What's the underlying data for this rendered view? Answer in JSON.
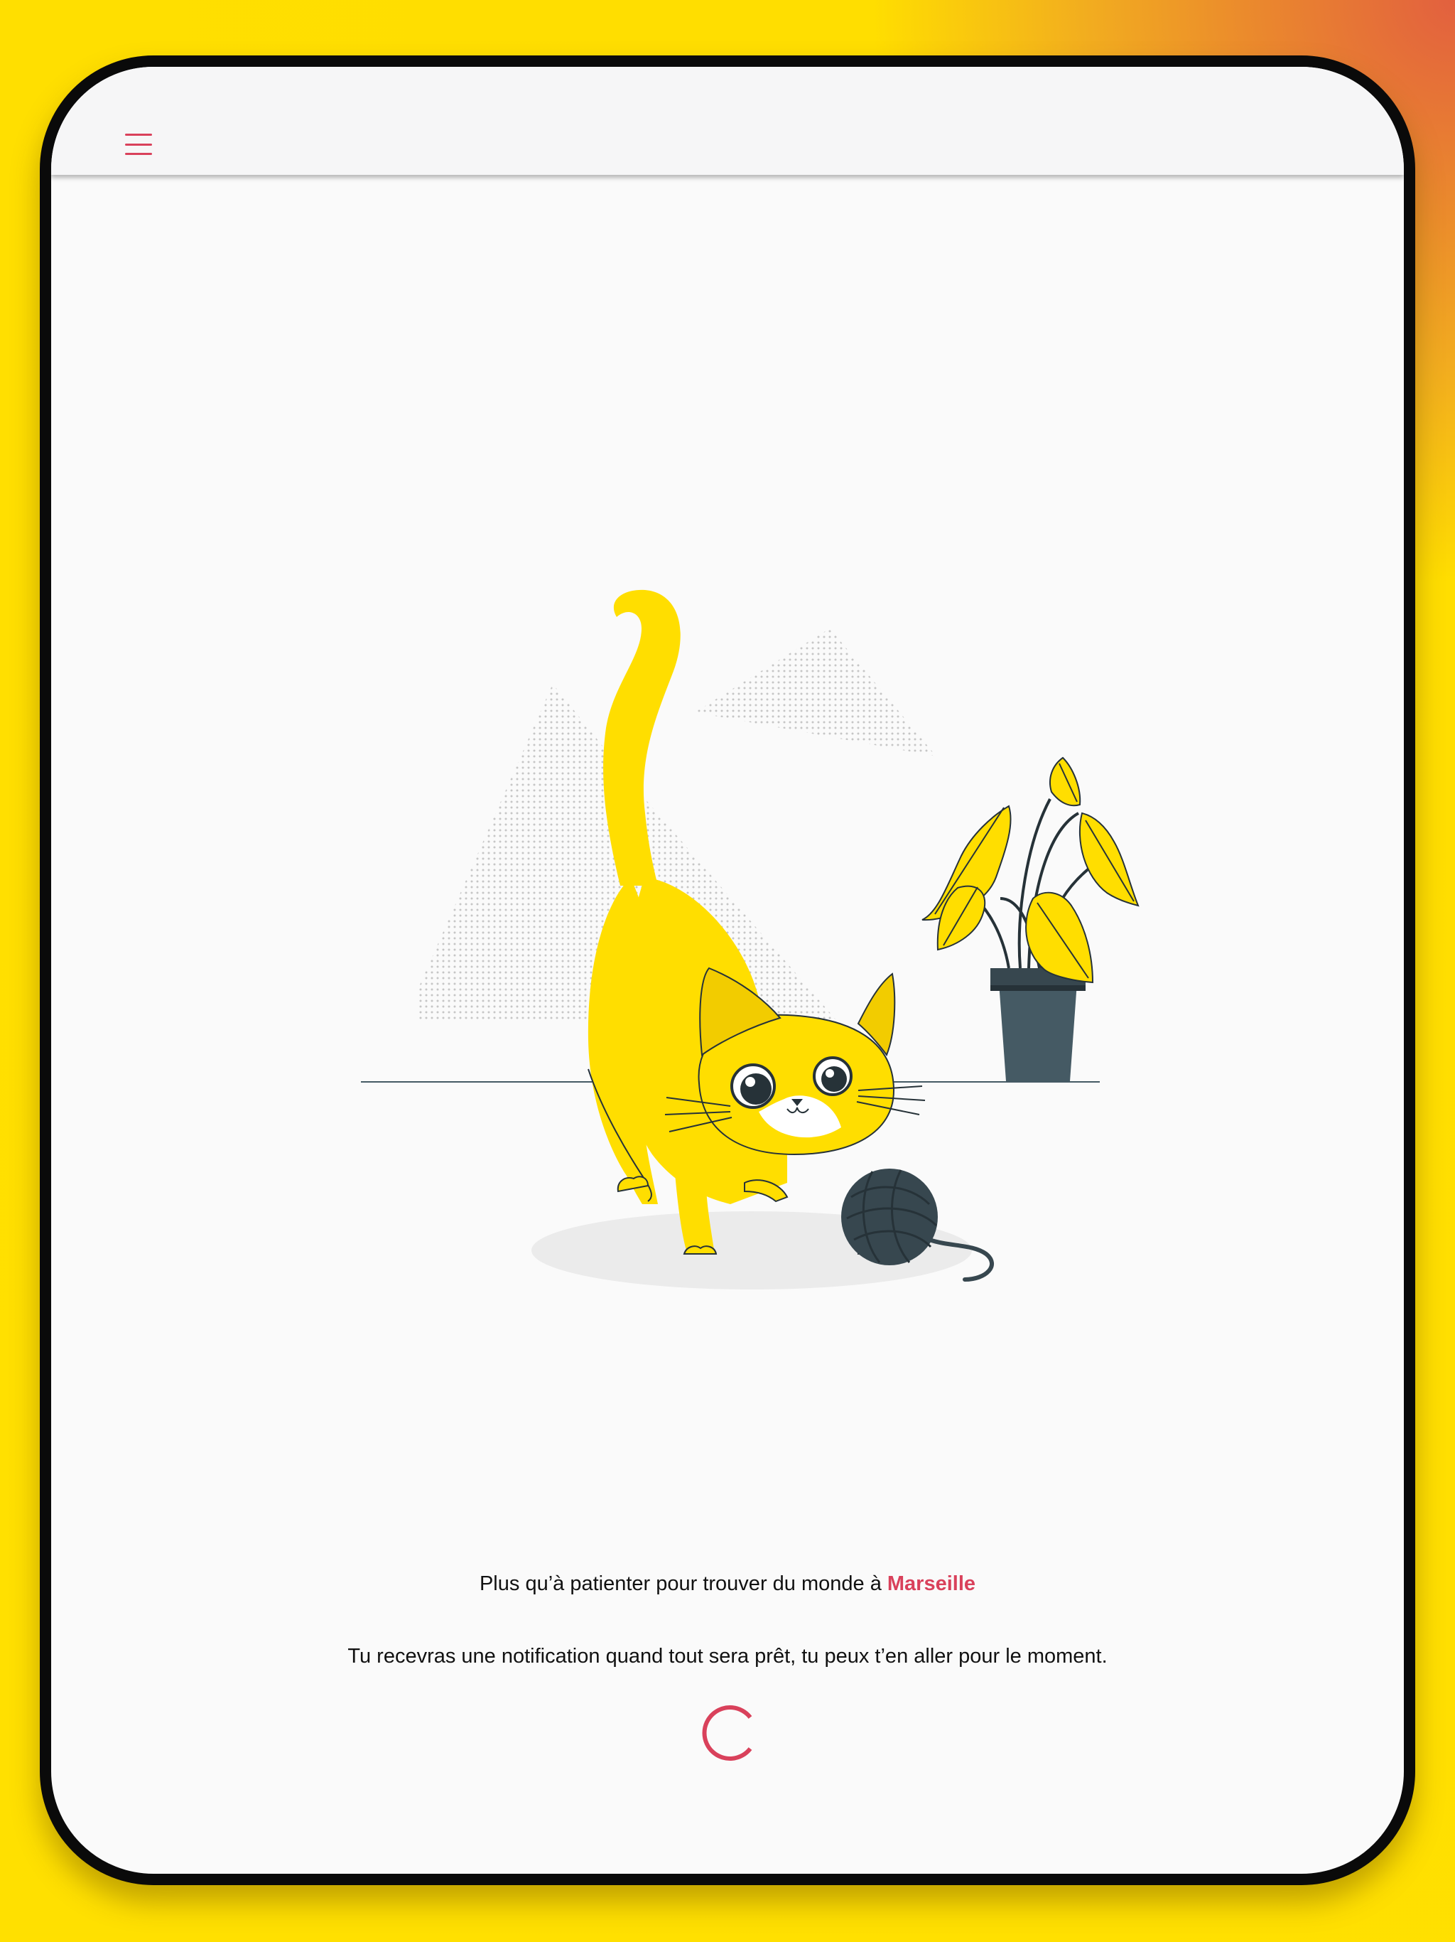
{
  "colors": {
    "accent": "#d9415b",
    "background": "#fafafa",
    "cat": "#ffde00",
    "dark": "#455a64"
  },
  "header": {
    "menu_icon": "hamburger-menu-icon"
  },
  "waiting": {
    "prefix": "Plus qu’à patienter pour trouver du monde à ",
    "city": "Marseille",
    "notification": "Tu recevras une notification quand tout sera prêt, tu peux t’en aller pour le moment."
  },
  "loader": {
    "icon": "loading-spinner-icon"
  }
}
